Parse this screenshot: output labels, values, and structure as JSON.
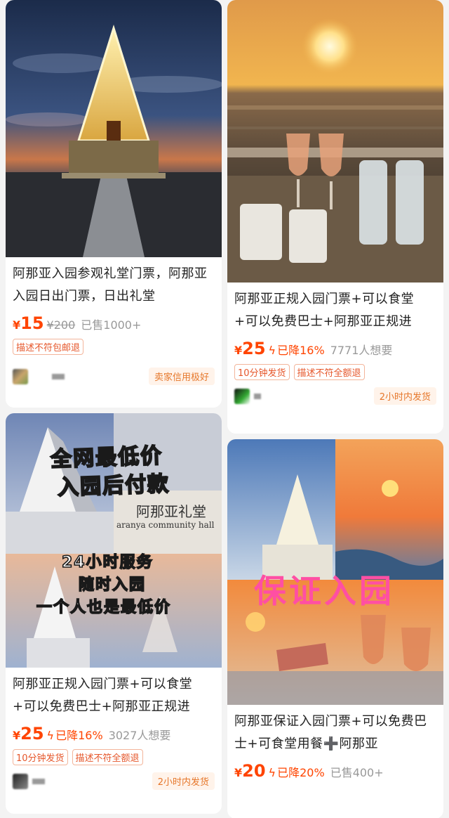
{
  "products": [
    {
      "title": "阿那亚入园参观礼堂门票，阿那亚入园日出门票，日出礼堂",
      "yen": "¥",
      "price": "15",
      "orig_price": "¥200",
      "stat": "已售1000+",
      "tags": [
        "描述不符包邮退"
      ],
      "badge": "卖家信用极好"
    },
    {
      "title": "阿那亚正规入园门票+可以食堂+可以免费巴士+阿那亚正规进",
      "yen": "¥",
      "price": "25",
      "drop": "已降16%",
      "stat": "7771人想要",
      "tags": [
        "10分钟发货",
        "描述不符全额退"
      ],
      "badge": "2小时内发货"
    },
    {
      "title": "阿那亚正规入园门票+可以食堂+可以免费巴士+阿那亚正规进",
      "yen": "¥",
      "price": "25",
      "drop": "已降16%",
      "stat": "3027人想要",
      "tags": [
        "10分钟发货",
        "描述不符全额退"
      ],
      "badge": "2小时内发货",
      "overlay": {
        "line1": "全网最低价",
        "line2": "入园后付款",
        "hall_cn": "阿那亚礼堂",
        "hall_en": "aranya community hall",
        "line3": "24小时服务",
        "line4": "随时入园",
        "line5": "一个人也是最低价"
      }
    },
    {
      "title": "阿那亚保证入园门票+可以免费巴士+可食堂用餐➕阿那亚",
      "yen": "¥",
      "price": "20",
      "drop": "已降20%",
      "stat": "已售400+",
      "overlay": {
        "text": "保证入园"
      }
    }
  ],
  "colors": {
    "price": "#ff4400",
    "tag_border": "#f3b59b",
    "badge_text": "#e6772b"
  }
}
